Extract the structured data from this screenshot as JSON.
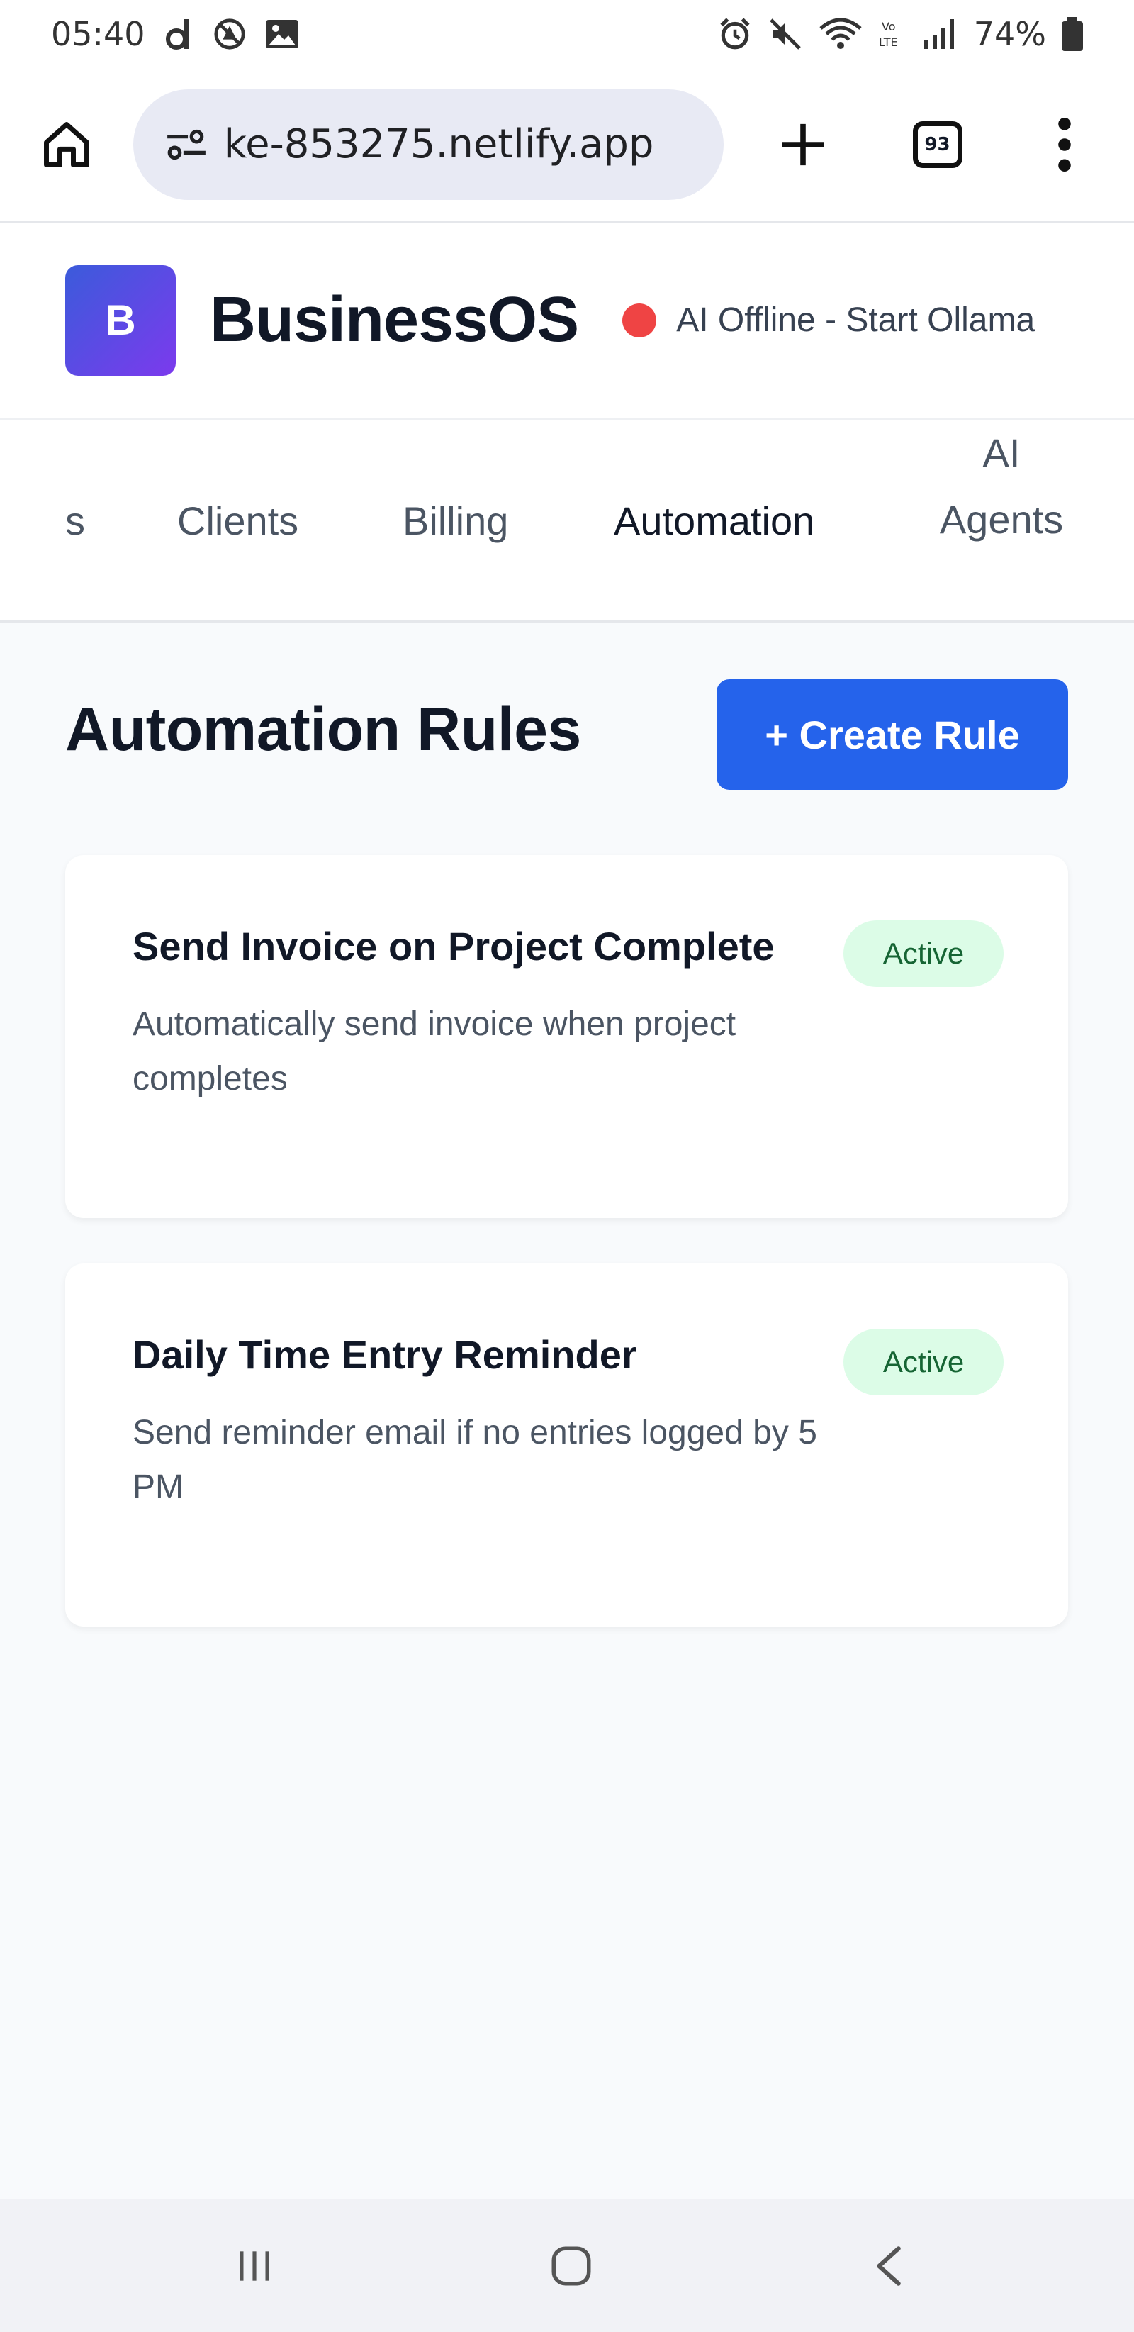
{
  "status_bar": {
    "time": "05:40",
    "battery": "74%",
    "left_icons": [
      "d-app-icon",
      "no-sync-icon",
      "image-icon"
    ],
    "right_icons": [
      "alarm-icon",
      "mute-icon",
      "wifi-icon",
      "volte-icon",
      "signal-icon",
      "battery-icon"
    ]
  },
  "browser": {
    "url": "ke-853275.netlify.app",
    "tab_count": "93"
  },
  "app": {
    "title": "BusinessOS",
    "logo_letter": "B",
    "ai_status": "AI Offline - Start Ollama",
    "status_color": "#ef4444"
  },
  "nav": {
    "tabs": [
      {
        "label": "s",
        "active": false
      },
      {
        "label": "Clients",
        "active": false
      },
      {
        "label": "Billing",
        "active": false
      },
      {
        "label": "Automation",
        "active": true
      },
      {
        "label": "AI Agents",
        "active": false
      }
    ]
  },
  "main": {
    "title": "Automation Rules",
    "create_label": "+ Create Rule",
    "accent": "#2563eb",
    "rules": [
      {
        "name": "Send Invoice on Project Complete",
        "description": "Automatically send invoice when project completes",
        "status": "Active"
      },
      {
        "name": "Daily Time Entry Reminder",
        "description": "Send reminder email if no entries logged by 5 PM",
        "status": "Active"
      }
    ]
  }
}
